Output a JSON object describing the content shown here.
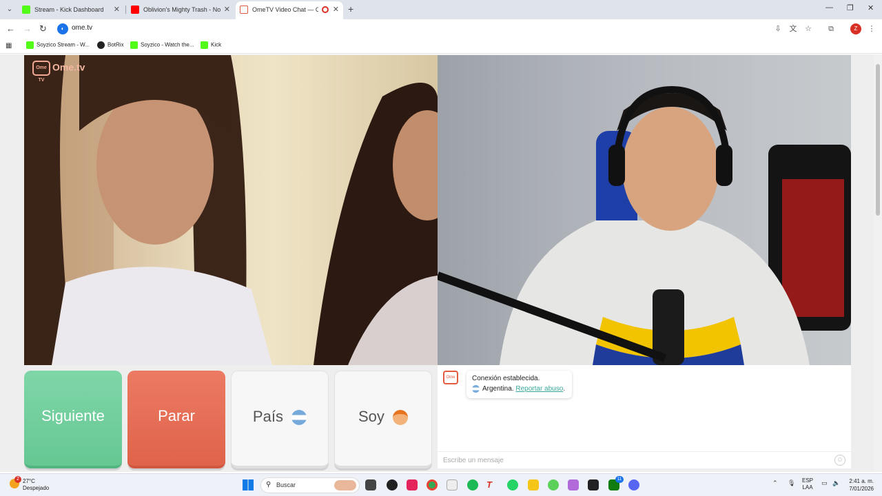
{
  "browser": {
    "tabs": [
      {
        "title": "Stream - Kick Dashboard",
        "favicon_color": "#53fc18",
        "active": false
      },
      {
        "title": "Oblivion's Mighty Trash - No M",
        "favicon_color": "#ff0000",
        "active": false
      },
      {
        "title": "OmeTV Video Chat — Ome",
        "favicon_color": "#e35b3e",
        "active": true
      }
    ],
    "url": "ome.tv",
    "bookmarks": [
      "Soyzico Stream - W...",
      "BotRix",
      "Soyzico - Watch the...",
      "Kick"
    ]
  },
  "page": {
    "logo_text": "Ome.tv",
    "logo_small": "Ome TV",
    "buttons": {
      "next": "Siguiente",
      "stop": "Parar",
      "country": "País",
      "gender": "Soy"
    },
    "chat": {
      "status": "Conexión establecida.",
      "country": "Argentina.",
      "report_link": "Reportar abuso",
      "report_suffix": ".",
      "input_placeholder": "Escribe un mensaje"
    }
  },
  "taskbar": {
    "temperature": "27°C",
    "weather": "Despejado",
    "search_label": "Buscar",
    "language_top": "ESP",
    "language_bottom": "LAA",
    "time": "2:41 a. m.",
    "date": "7/01/2026",
    "notification_count": "2",
    "xbox_badge": "11"
  },
  "colors": {
    "next_button": "#70cf9d",
    "stop_button": "#e6705a",
    "accent_link": "#3aa89a"
  }
}
